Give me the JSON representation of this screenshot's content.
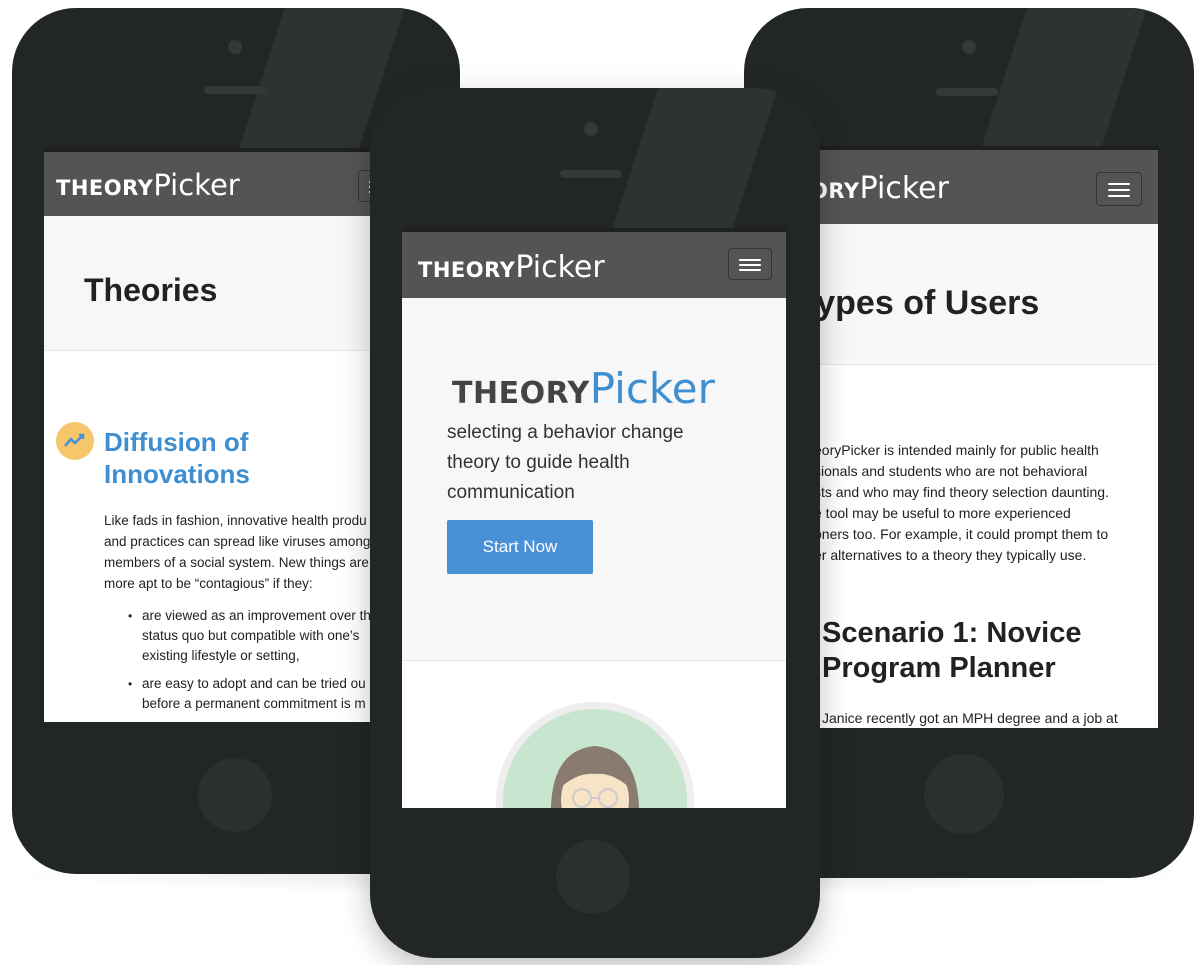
{
  "app": {
    "logo_bold": "THEORY",
    "logo_light": "Picker"
  },
  "colors": {
    "navbar": "#545454",
    "accent_blue": "#4a90d6",
    "heading_blue": "#3d8fd2",
    "phone_body": "#222726"
  },
  "left_screen": {
    "page_title": "Theories",
    "section_icon": "trend-chart-icon",
    "section_title": "Diffusion of Innovations",
    "intro_lines": [
      "Like fads in fashion, innovative health produ",
      "and practices can spread like viruses among",
      "members of a social system. New things are",
      "more apt to be “contagious” if they:"
    ],
    "bullets": [
      [
        "are viewed as an improvement over th",
        "status quo but compatible with one’s",
        "existing lifestyle or setting,"
      ],
      [
        "are easy to adopt and can be tried ou",
        "before a permanent commitment is m"
      ]
    ]
  },
  "center_screen": {
    "hero_logo_bold": "THEORY",
    "hero_logo_light": "Picker",
    "tagline_lines": [
      "selecting a behavior change",
      "theory to guide health",
      "communication"
    ],
    "start_button": "Start Now",
    "avatar": "female-user-avatar-icon"
  },
  "right_screen": {
    "logo_bold_cut": "ORY",
    "page_title": "Types of Users",
    "intro_lines": [
      "eoryPicker is intended mainly for public health",
      "sionals and students who are not behavioral",
      "sts and who may find theory selection daunting.",
      "e tool may be useful to more experienced",
      "oners too. For example, it could prompt them to",
      "er alternatives to a theory they typically use."
    ],
    "scenario_title_lines": [
      "Scenario 1: Novice",
      "Program Planner"
    ],
    "scenario_text": "Janice recently got an MPH degree and a job at"
  }
}
